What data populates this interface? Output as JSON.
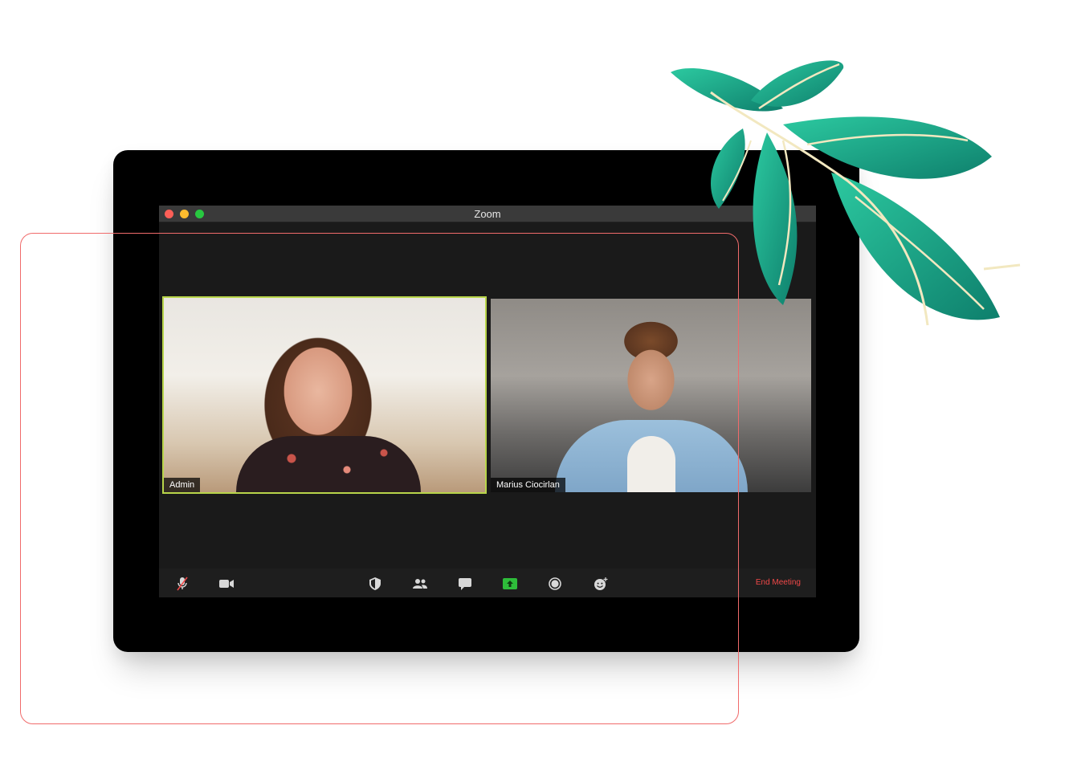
{
  "window": {
    "title": "Zoom"
  },
  "participants": [
    {
      "name": "Admin",
      "active_speaker": true
    },
    {
      "name": "Marius Ciocirlan",
      "active_speaker": false
    }
  ],
  "toolbar": {
    "left_icons": [
      "mic-muted-icon",
      "video-camera-icon"
    ],
    "center_icons": [
      "security-shield-icon",
      "participants-icon",
      "chat-icon",
      "share-screen-icon",
      "record-icon",
      "reactions-icon"
    ],
    "end_meeting_label": "End Meeting"
  },
  "colors": {
    "active_speaker_border": "#b8d54a",
    "end_meeting": "#f04848",
    "share_screen": "#2ebd3a",
    "outline_frame": "#f06b6b",
    "leaf": "#1fa888"
  }
}
